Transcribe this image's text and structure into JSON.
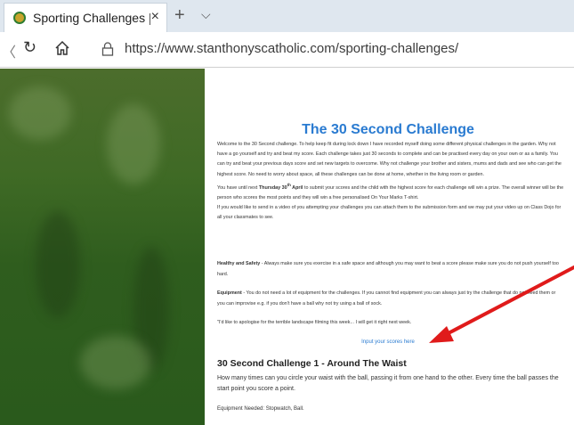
{
  "browser": {
    "tab_title": "Sporting Challenges | St",
    "tab_close": "×",
    "new_tab": "+",
    "tab_menu": "⌵",
    "back": "〈",
    "refresh": "↻",
    "url": "https://www.stanthonyscatholic.com/sporting-challenges/"
  },
  "page": {
    "title": "The 30 Second Challenge",
    "intro_before": "Welcome to the 30 Second challenge. To help keep fit during lock down I have recorded myself doing some different physical challenges in the garden. Why not have a go yourself and try and beat my score. Each challenge takes just 30 seconds to complete and can be practised every day on your own or as a family. You can try and beat your previous days score and set new targets to overcome. Why not challenge your brother and sisters, mums and dads and see who can get the highest score. No need to worry about space, all these challenges can be done at home, whether in the living room or garden.",
    "deadline_prefix": "You have until next ",
    "deadline_day": "Thursday 30",
    "deadline_sup": "th",
    "deadline_month": " April",
    "deadline_suffix": " to submit your scores and the child with the highest score for each challenge will win a prize. The overall winner will be the person who scores the most points and they will win a free personalised On Your Marks T-shirt.",
    "video_text": "If you would like to send in a video of you attempting your challenges you can attach them to the submission form and we may put your video up on Class Dojo for all your classmates to see.",
    "safety_label": "Healthy and Safety",
    "safety_text": " - Always make sure you exercise in a safe space and although you may want to beat a score please make sure you do not push yourself too hard.",
    "equipment_label": "Equipment",
    "equipment_text": " - You do not need a lot of equipment for the challenges. If you cannot find equipment you can always just try the challenge that do not need them or you can improvise e.g. if you don't have a ball why not try using a ball of sock.",
    "apology": "\"I'd like to apologise for the terrible landscape filming this week... I will get it right next week.",
    "scores_link": "Input your scores here",
    "challenge_heading": "30 Second Challenge 1 - Around The Waist",
    "challenge_desc": "How many times can you circle your waist with the ball, passing it from one hand to the other. Every time the ball passes the start point you score a point.",
    "challenge_equipment": "Equipment Needed: Stopwatch, Ball."
  },
  "colors": {
    "title": "#2a7bd1",
    "link": "#2a7bd1",
    "annotation_arrow": "#e01b1b",
    "sidebar_green": "#2f5d1e"
  },
  "icons": [
    "favicon-icon",
    "close-icon",
    "plus-icon",
    "chevron-down-icon",
    "back-icon",
    "refresh-icon",
    "home-icon",
    "lock-icon",
    "red-arrow-annotation"
  ]
}
